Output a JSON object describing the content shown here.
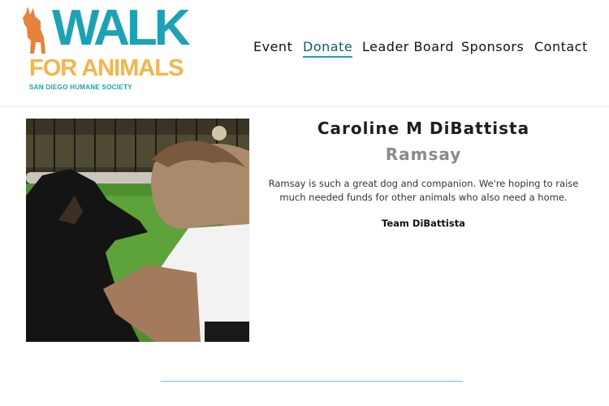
{
  "logo": {
    "word_walk": "WALK",
    "word_for_animals": "FOR ANIMALS",
    "subtitle": "SAN DIEGO HUMANE SOCIETY",
    "colors": {
      "teal": "#1aa3b4",
      "orange": "#f6b44a",
      "dog": "#e8813a"
    }
  },
  "nav": {
    "items": [
      {
        "label": "Event",
        "active": false
      },
      {
        "label": "Donate",
        "active": true
      },
      {
        "label": "Leader Board",
        "active": false
      },
      {
        "label": "Sponsors",
        "active": false
      },
      {
        "label": "Contact",
        "active": false
      }
    ]
  },
  "profile": {
    "name": "Caroline M DiBattista",
    "pet_name": "Ramsay",
    "story": "Ramsay is such a great dog and companion. We're hoping to raise much needed funds for other animals who also need a home.",
    "team": "Team DiBattista"
  }
}
